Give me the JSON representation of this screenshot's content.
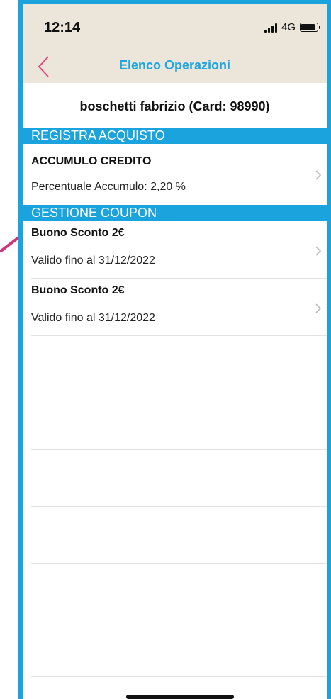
{
  "status_bar": {
    "time": "12:14",
    "network": "4G",
    "battery_level": 0.8
  },
  "nav": {
    "title": "Elenco Operazioni"
  },
  "customer_header": "boschetti fabrizio (Card: 98990)",
  "sections": {
    "registra": {
      "title": "REGISTRA ACQUISTO",
      "item": {
        "title": "ACCUMULO CREDITO",
        "subtitle": "Percentuale Accumulo: 2,20 %"
      }
    },
    "coupon": {
      "title": "GESTIONE COUPON",
      "items": [
        {
          "title": "Buono Sconto 2€",
          "subtitle": "Valido fino al 31/12/2022"
        },
        {
          "title": "Buono Sconto 2€",
          "subtitle": "Valido fino al 31/12/2022"
        }
      ]
    }
  },
  "colors": {
    "accent": "#1aa3dc",
    "back": "#e8457f",
    "annotation": "#d6337b",
    "topbar": "#ece5da"
  }
}
